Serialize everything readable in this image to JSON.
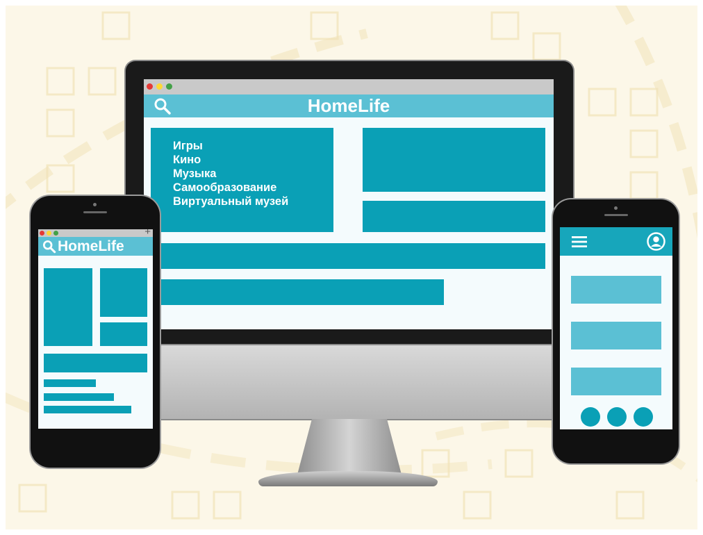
{
  "desktop": {
    "title": "HomeLife",
    "menu_items": [
      "Игры",
      "Кино",
      "Музыка",
      "Самообразование",
      "Виртуальный музей"
    ]
  },
  "phone_left": {
    "title": "HomeLife",
    "plus": "+"
  },
  "colors": {
    "background": "#fcf7e8",
    "primary": "#0aa0b6",
    "header": "#5bc0d4",
    "screen": "#f4fbfd",
    "device_bezel": "#111111",
    "chrome_bar": "#c9c9c9",
    "dot_red": "#e53935",
    "dot_yellow": "#fdd835",
    "dot_green": "#43a047"
  },
  "icons": {
    "search": "search-icon",
    "menu": "hamburger-menu-icon",
    "user": "user-avatar-icon"
  }
}
